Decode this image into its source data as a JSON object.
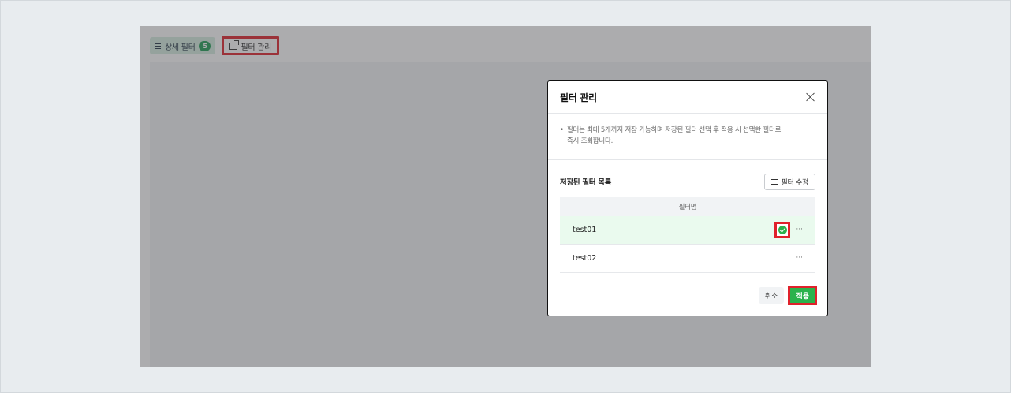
{
  "toolbar": {
    "detail_filter_label": "상세 필터",
    "detail_filter_count": "5",
    "manage_filter_label": "필터 관리"
  },
  "modal": {
    "title": "필터 관리",
    "notice_bullet": "•",
    "notice_line1": "필터는 최대 5개까지 저장 가능하며 저장된 필터 선택 후 적용 시 선택한 필터로",
    "notice_line2": "즉시 조회합니다.",
    "section_title": "저장된 필터 목록",
    "edit_button_label": "필터 수정",
    "table": {
      "column_header": "필터명",
      "rows": [
        {
          "name": "test01",
          "selected": true,
          "more": "···"
        },
        {
          "name": "test02",
          "selected": false,
          "more": "···"
        }
      ]
    },
    "cancel_label": "취소",
    "apply_label": "적용"
  },
  "colors": {
    "accent_green": "#2bb24c",
    "highlight_red": "#e0212b",
    "selected_row_bg": "#eafaee"
  },
  "icons": [
    "list-icon",
    "export-icon",
    "close-icon",
    "check-circle-icon",
    "more-icon"
  ]
}
